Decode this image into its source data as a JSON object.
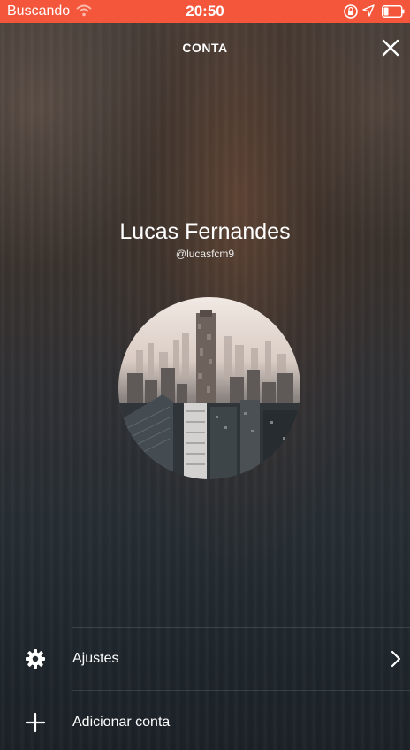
{
  "status_bar": {
    "carrier": "Buscando",
    "time": "20:50",
    "bar_color": "#f4563b"
  },
  "header": {
    "title": "CONTA",
    "close_icon": "close-icon"
  },
  "profile": {
    "name": "Lucas Fernandes",
    "handle": "@lucasfcm9",
    "avatar": "city-skyline-photo"
  },
  "menu": {
    "items": [
      {
        "label": "Ajustes",
        "icon": "gear-icon",
        "has_chevron": true
      },
      {
        "label": "Adicionar conta",
        "icon": "plus-icon",
        "has_chevron": false
      }
    ]
  }
}
